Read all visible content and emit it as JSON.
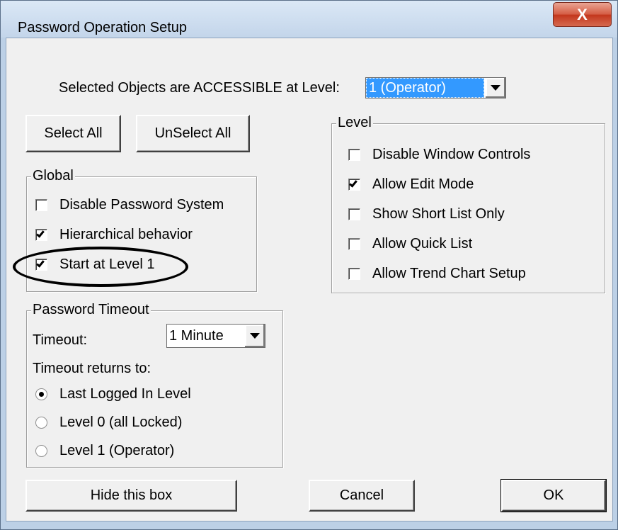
{
  "window": {
    "title": "Password Operation Setup",
    "close_glyph": "X"
  },
  "access_level": {
    "label": "Selected Objects are ACCESSIBLE at Level:",
    "selected_value": "1 (Operator)"
  },
  "buttons": {
    "select_all": "Select All",
    "unselect_all": "UnSelect All",
    "hide_box": "Hide this box",
    "cancel": "Cancel",
    "ok": "OK"
  },
  "global_group": {
    "title": "Global",
    "items": [
      {
        "label": "Disable Password System",
        "checked": false
      },
      {
        "label": "Hierarchical behavior",
        "checked": true
      },
      {
        "label": "Start at Level 1",
        "checked": true
      }
    ]
  },
  "level_group": {
    "title": "Level",
    "items": [
      {
        "label": "Disable Window Controls",
        "checked": false
      },
      {
        "label": "Allow Edit Mode",
        "checked": true
      },
      {
        "label": "Show Short List Only",
        "checked": false
      },
      {
        "label": "Allow Quick List",
        "checked": false
      },
      {
        "label": "Allow Trend Chart Setup",
        "checked": false
      }
    ]
  },
  "timeout_group": {
    "title": "Password Timeout",
    "timeout_label": "Timeout:",
    "timeout_value": "1 Minute",
    "returns_label": "Timeout returns to:",
    "options": [
      {
        "label": "Last Logged In Level",
        "selected": true
      },
      {
        "label": "Level 0 (all Locked)",
        "selected": false
      },
      {
        "label": "Level 1 (Operator)",
        "selected": false
      }
    ]
  },
  "colors": {
    "dialog_bg": "#f0f0f0",
    "frame": "#bcd0e6",
    "selection": "#3399ff",
    "close_button": "#c3361c"
  }
}
